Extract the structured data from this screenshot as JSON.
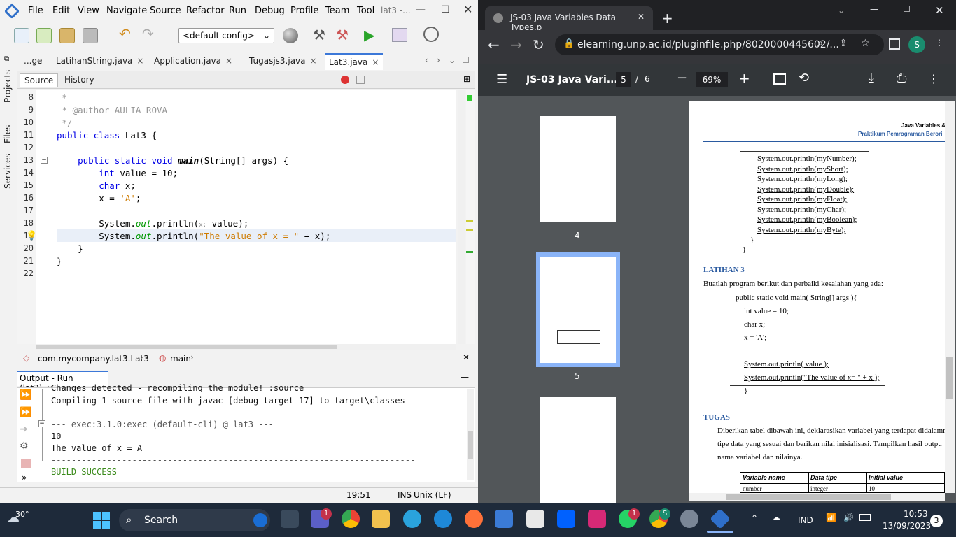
{
  "netbeans": {
    "menu": [
      "File",
      "Edit",
      "View",
      "Navigate",
      "Source",
      "Refactor",
      "Run",
      "Debug",
      "Profile",
      "Team",
      "Tool"
    ],
    "window_title": "lat3 -...",
    "config": "<default config>",
    "tabs": [
      {
        "label": "...ge"
      },
      {
        "label": "LatihanString.java"
      },
      {
        "label": "Application.java"
      },
      {
        "label": "Tugasjs3.java"
      },
      {
        "label": "Lat3.java"
      }
    ],
    "editor_toolbar": {
      "source": "Source",
      "history": "History"
    },
    "side_tabs": [
      "Projects",
      "Files",
      "Services"
    ],
    "line_numbers": [
      "8",
      "9",
      "10",
      "11",
      "12",
      "13",
      "14",
      "15",
      "16",
      "17",
      "18",
      "19",
      "20",
      "21",
      "22"
    ],
    "code": {
      "l8": " *",
      "l9": " * @author AULIA ROVA",
      "l10": " */",
      "l11_kw": "public class",
      "l11_rest": " Lat3 {",
      "l13_kw": "    public static void",
      "l13_name": "main",
      "l13_rest": "(String[] args) {",
      "l14_kw": "        int",
      "l14_rest": " value = 10;",
      "l15_kw": "        char",
      "l15_rest": " x;",
      "l16_a": "        x",
      "l16_b": " = ",
      "l16_c": "'A'",
      "l16_d": ";",
      "l18_a": "        System.",
      "l18_out": "out",
      "l18_b": ".println(",
      "l18_hint": "x:",
      "l18_c": " value);",
      "l19_a": "        System.",
      "l19_out": "out",
      "l19_b": ".println(",
      "l19_str": "\"The value of x = \"",
      "l19_c": " + x);",
      "l20": "    }",
      "l21": "}"
    },
    "breadcrumb": {
      "class": "com.mycompany.lat3.Lat3",
      "method": "main"
    },
    "output": {
      "title": "Output - Run (lat3)",
      "lines": [
        "Changes detected - recompiling the module! :source",
        "Compiling 1 source file with javac [debug target 17] to target\\classes",
        "",
        "--- exec:3.1.0:exec (default-cli) @ lat3 ---",
        "10",
        "The value of x = A",
        "------------------------------------------------------------------------",
        "BUILD SUCCESS"
      ]
    },
    "status": {
      "pos": "19:51",
      "mode": "INS",
      "eol": "Unix (LF)"
    }
  },
  "chrome": {
    "tab_title": "JS-03 Java Variables Data Types.p",
    "url": "elearning.unp.ac.id/pluginfile.php/8020000445602/...",
    "profile": "S",
    "pdf": {
      "title": "JS-03 Java Vari...",
      "page": "5",
      "total": "6",
      "zoom": "69%",
      "thumb_labels": [
        "4",
        "5"
      ]
    },
    "doc": {
      "header1": "Java Variables &",
      "header2": "Praktikum Pemrograman Berori",
      "println_lines": [
        "System.out.println(myNumber);",
        "System.out.println(myShort);",
        "System.out.println(myLong);",
        "System.out.println(myDouble);",
        "System.out.println(myFloat);",
        "System.out.println(myChar);",
        "System.out.println(myBoolean);",
        "System.out.println(myByte);"
      ],
      "brace1": "}",
      "brace2": "}",
      "latihan": "LATIHAN 3",
      "latihan_desc": "Buatlah program berikut dan perbaiki kesalahan yang ada:",
      "code_lines": [
        "public static void main( String[] args ){",
        "int value = 10;",
        "char x;",
        "x = 'A';",
        "",
        "System.out.println( value );",
        "System.out.println(\"The value of x= \" + x );"
      ],
      "code_end": "}",
      "tugas": "TUGAS",
      "tugas_desc": [
        "Diberikan tabel dibawah ini, deklarasikan variabel yang terdapat didalamn",
        "tipe data yang sesuai dan berikan nilai inisialisasi. Tampilkan hasil outpu",
        "nama variabel dan nilainya."
      ],
      "table_headers": [
        "Variable name",
        "Data tipe",
        "Initial value"
      ],
      "table_row": [
        "number",
        "integer",
        "10"
      ]
    }
  },
  "taskbar": {
    "weather": "30°",
    "search": "Search",
    "lang": "IND",
    "time": "10:53",
    "date": "13/09/2023",
    "notif": "3",
    "badge_teams": "1",
    "badge_whatsapp": "1",
    "badge_chrome": "S"
  }
}
